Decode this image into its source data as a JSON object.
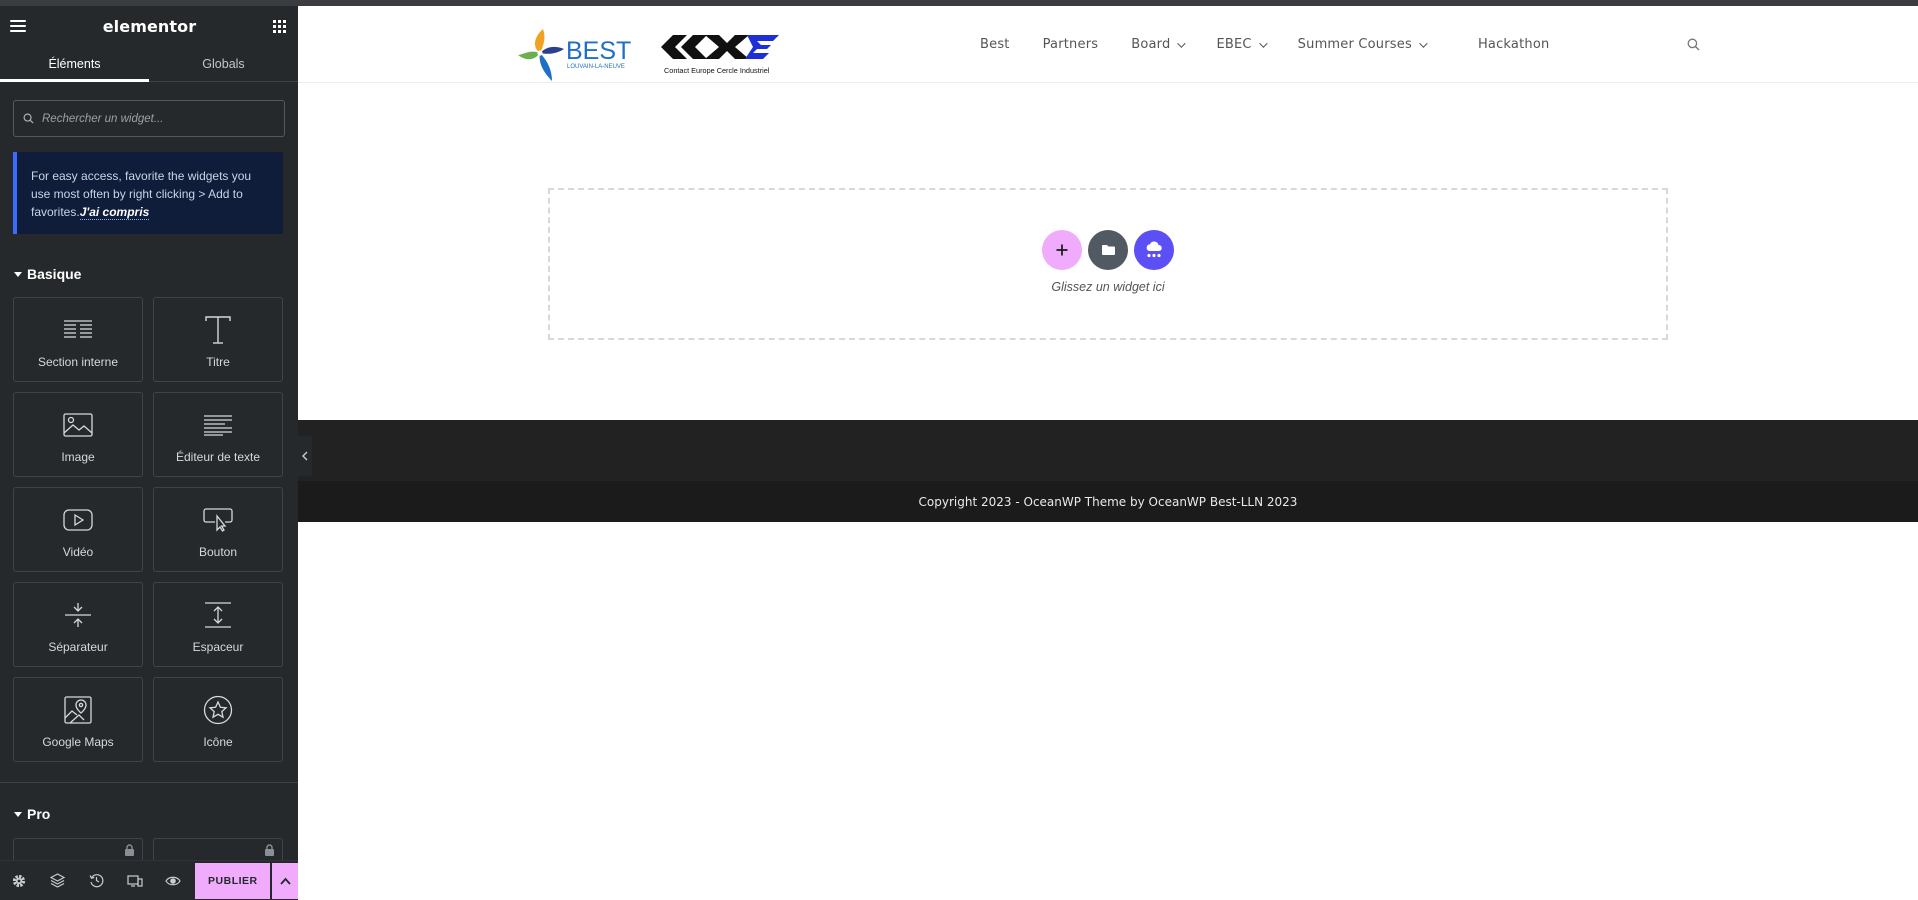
{
  "editor": {
    "title": "elementor",
    "tabs": [
      {
        "label": "Éléments",
        "active": true
      },
      {
        "label": "Globals",
        "active": false
      }
    ],
    "search": {
      "placeholder": "Rechercher un widget...",
      "value": ""
    },
    "tip": {
      "text": "For easy access, favorite the widgets you use most often by right clicking > Add to favorites.",
      "link": "J'ai compris"
    },
    "categories": {
      "basic": {
        "label": "Basique",
        "widgets": [
          {
            "label": "Section interne",
            "icon": "inner-section-icon"
          },
          {
            "label": "Titre",
            "icon": "heading-icon"
          },
          {
            "label": "Image",
            "icon": "image-icon"
          },
          {
            "label": "Éditeur de texte",
            "icon": "text-editor-icon"
          },
          {
            "label": "Vidéo",
            "icon": "video-icon"
          },
          {
            "label": "Bouton",
            "icon": "button-icon"
          },
          {
            "label": "Séparateur",
            "icon": "divider-icon"
          },
          {
            "label": "Espaceur",
            "icon": "spacer-icon"
          },
          {
            "label": "Google Maps",
            "icon": "google-maps-icon"
          },
          {
            "label": "Icône",
            "icon": "star-icon"
          }
        ]
      },
      "pro": {
        "label": "Pro",
        "widgets": [
          {
            "icon": "posts-icon",
            "locked": true
          },
          {
            "icon": "portfolio-icon",
            "locked": true
          }
        ]
      }
    },
    "footer": {
      "icons": [
        "settings-icon",
        "navigator-layers-icon",
        "history-icon",
        "responsive-mode-icon",
        "preview-eye-icon"
      ],
      "publish_label": "PUBLIER"
    },
    "colors": {
      "panel": "#26292c",
      "accent": "#f0abfc",
      "tip_border": "#3b6cff"
    }
  },
  "site": {
    "logos": {
      "best": "BEST",
      "best_sub": "LOUVAIN-LA-NEUVE",
      "cecx_caption": "Contact Europe Cercle Industriel"
    },
    "nav": [
      {
        "label": "Best",
        "has_dropdown": false
      },
      {
        "label": "Partners",
        "has_dropdown": false
      },
      {
        "label": "Board",
        "has_dropdown": true
      },
      {
        "label": "EBEC",
        "has_dropdown": true
      },
      {
        "label": "Summer Courses",
        "has_dropdown": true
      },
      {
        "label": "Hackathon",
        "has_dropdown": false
      }
    ],
    "drop_zone": {
      "hint": "Glissez un widget ici"
    },
    "copyright": "Copyright 2023 - OceanWP Theme by OceanWP Best-LLN 2023"
  }
}
